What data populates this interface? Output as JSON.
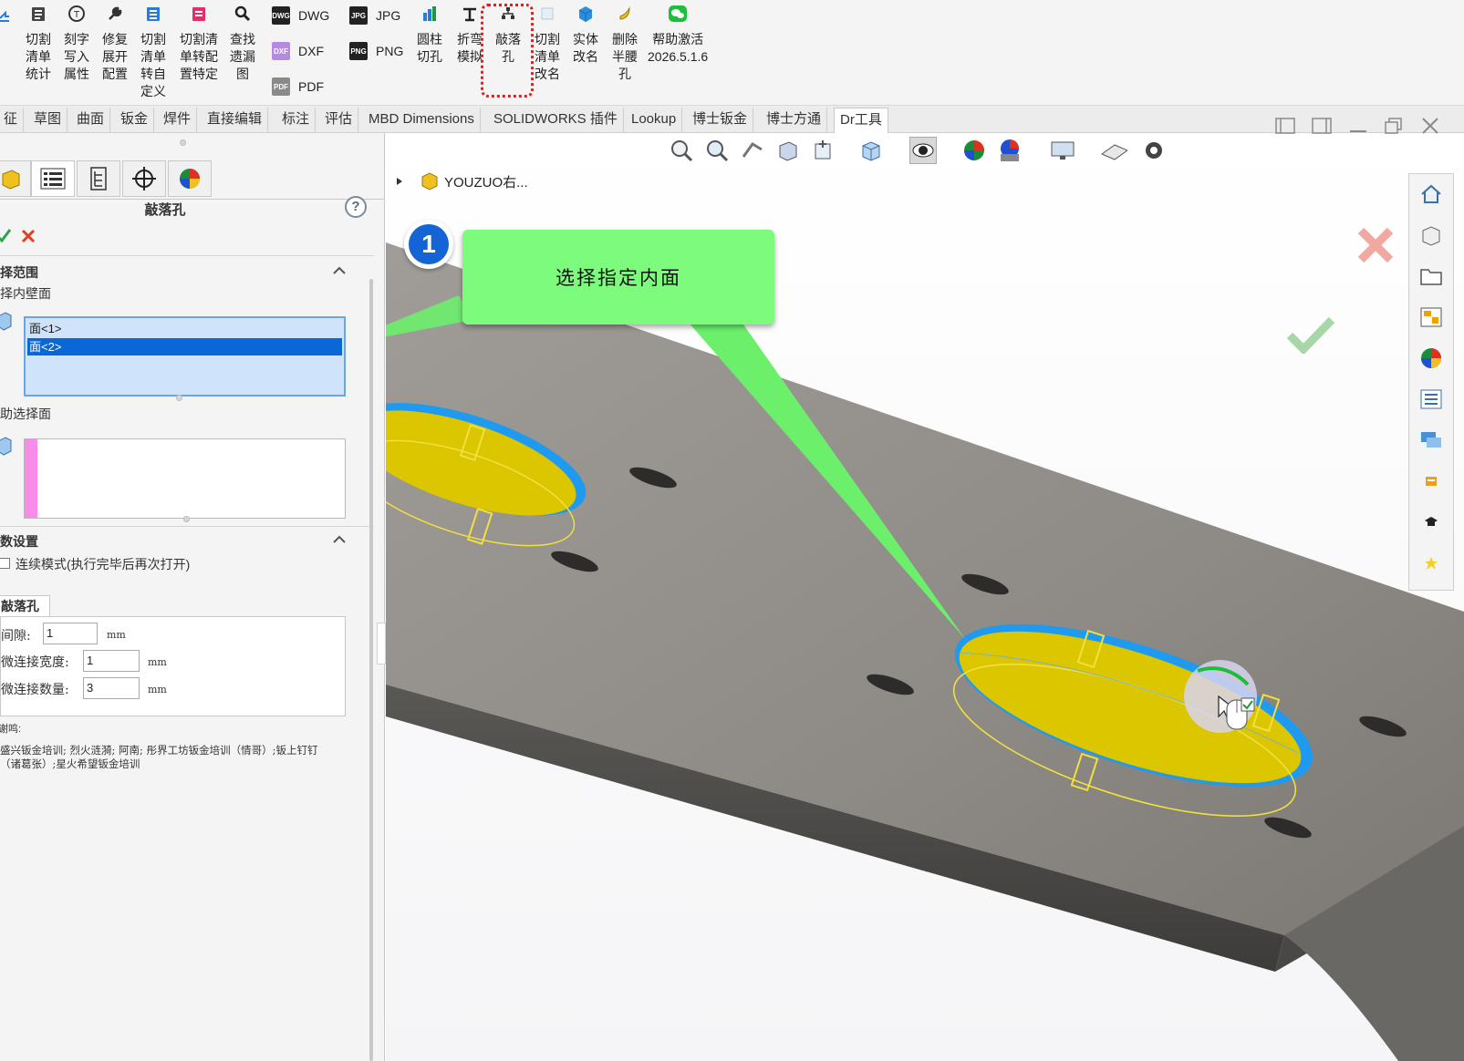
{
  "ribbon": {
    "buttons": [
      {
        "label": "切割\n清单\n统计",
        "icon": "clipboard-icon"
      },
      {
        "label": "刻字\n写入\n属性",
        "icon": "stamp-icon"
      },
      {
        "label": "修复\n展开\n配置",
        "icon": "wrench-icon"
      },
      {
        "label": "切割\n清单\n转自\n定义",
        "icon": "list-icon"
      },
      {
        "label": "切割清\n单转配\n置特定",
        "icon": "clipboard-red-icon"
      },
      {
        "label": "查找\n遗漏\n图",
        "icon": "search-icon"
      },
      {
        "label": "圆柱\n切孔",
        "icon": "cylinder-icon"
      },
      {
        "label": "折弯\n模拟",
        "icon": "bend-icon"
      },
      {
        "label": "敲落\n孔",
        "icon": "knockout-icon"
      },
      {
        "label": "切割\n清单\n改名",
        "icon": "rename-icon"
      },
      {
        "label": "实体\n改名",
        "icon": "cube-icon"
      },
      {
        "label": "删除\n半腰\n孔",
        "icon": "banana-icon"
      },
      {
        "label": "帮助激活\n2026.5.1.6",
        "icon": "wechat-icon"
      }
    ],
    "formats": [
      "DWG",
      "DXF",
      "PDF",
      "JPG",
      "PNG"
    ]
  },
  "tabs": [
    "征",
    "草图",
    "曲面",
    "钣金",
    "焊件",
    "直接编辑",
    "标注",
    "评估",
    "MBD Dimensions",
    "SOLIDWORKS 插件",
    "Lookup",
    "博士钣金",
    "博士方通",
    "Dr工具"
  ],
  "panel": {
    "title": "敲落孔",
    "help": "?",
    "sec_select": "选择范围",
    "lbl_inner": "选择内壁面",
    "faces": [
      "面<1>",
      "面<2>"
    ],
    "lbl_aux": "辅助选择面",
    "sec_params": "参数设置",
    "continuous": "连续模式(执行完毕后再次打开)",
    "group_tab": "敲落孔",
    "gap_label": "间隙:",
    "gap_value": "1",
    "gap_unit": "mm",
    "width_label": "微连接宽度:",
    "width_value": "1",
    "width_unit": "mm",
    "count_label": "微连接数量:",
    "count_value": "3",
    "count_unit": "mm",
    "thanks_label": "谢鸣:",
    "thanks_text": "盛兴钣金培训;  烈火涟漪;  阿南;  彤界工坊钣金培训（情哥）;钣上钉钉（诸葛张）;星火希望钣金培训"
  },
  "viewport": {
    "tree_label": "YOUZUO右...",
    "callout_number": "1",
    "callout_text": "选择指定内面"
  },
  "colors": {
    "accent_blue": "#0a67d6",
    "callout_green": "#7dfb7d",
    "plate_gray": "#8d8985",
    "face_yellow": "#dcc600",
    "highlight_red": "#e02020"
  }
}
